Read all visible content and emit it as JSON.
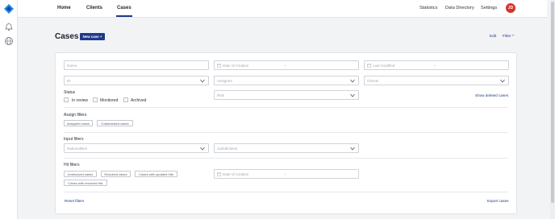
{
  "rail": {
    "icons": [
      "logo-icon",
      "bell-icon",
      "globe-icon"
    ]
  },
  "topnav": {
    "tabs": [
      {
        "label": "Home"
      },
      {
        "label": "Clients"
      },
      {
        "label": "Cases"
      }
    ],
    "active_tab": "Cases",
    "links": [
      {
        "label": "Statistics"
      },
      {
        "label": "Data Directory"
      },
      {
        "label": "Settings"
      }
    ],
    "avatar_initials": "JD"
  },
  "page": {
    "title": "Cases",
    "new_case_label": "New case +",
    "edit_label": "Edit",
    "filter_label": "Filter ^"
  },
  "filters": {
    "name_placeholder": "Name",
    "date_of_creation_placeholder": "Date of creation",
    "last_modified_placeholder": "Last modified",
    "date_separator": "–",
    "id_placeholder": "ID",
    "assignee_placeholder": "Assignee",
    "clients_placeholder": "Clients",
    "status_label": "Status",
    "status_options": [
      {
        "label": "In review"
      },
      {
        "label": "Monitored"
      },
      {
        "label": "Archived"
      }
    ],
    "risk_placeholder": "Risk",
    "show_deleted_label": "Show deleted cases",
    "assign_filters_label": "Assign filters",
    "assign_chips": [
      {
        "label": "Assigned cases"
      },
      {
        "label": "Collaborated cases"
      }
    ],
    "input_filters_label": "Input filters",
    "nationalities_placeholder": "Nationalities",
    "jurisdictions_placeholder": "Jurisdictions",
    "hit_filters_label": "Hit filters",
    "hit_chips": [
      {
        "label": "Unresolved cases"
      },
      {
        "label": "Resolved cases"
      },
      {
        "label": "Cases with updated hits"
      },
      {
        "label": "Cases with resolved hits"
      }
    ],
    "hit_date_placeholder": "Date of creation",
    "reset_label": "Reset filters",
    "export_label": "Export cases"
  },
  "colors": {
    "accent": "#1e3a8a",
    "avatar": "#d6332c",
    "border": "#cfd3d8",
    "placeholder": "#a3a8b0",
    "background": "#f2f3f5"
  }
}
